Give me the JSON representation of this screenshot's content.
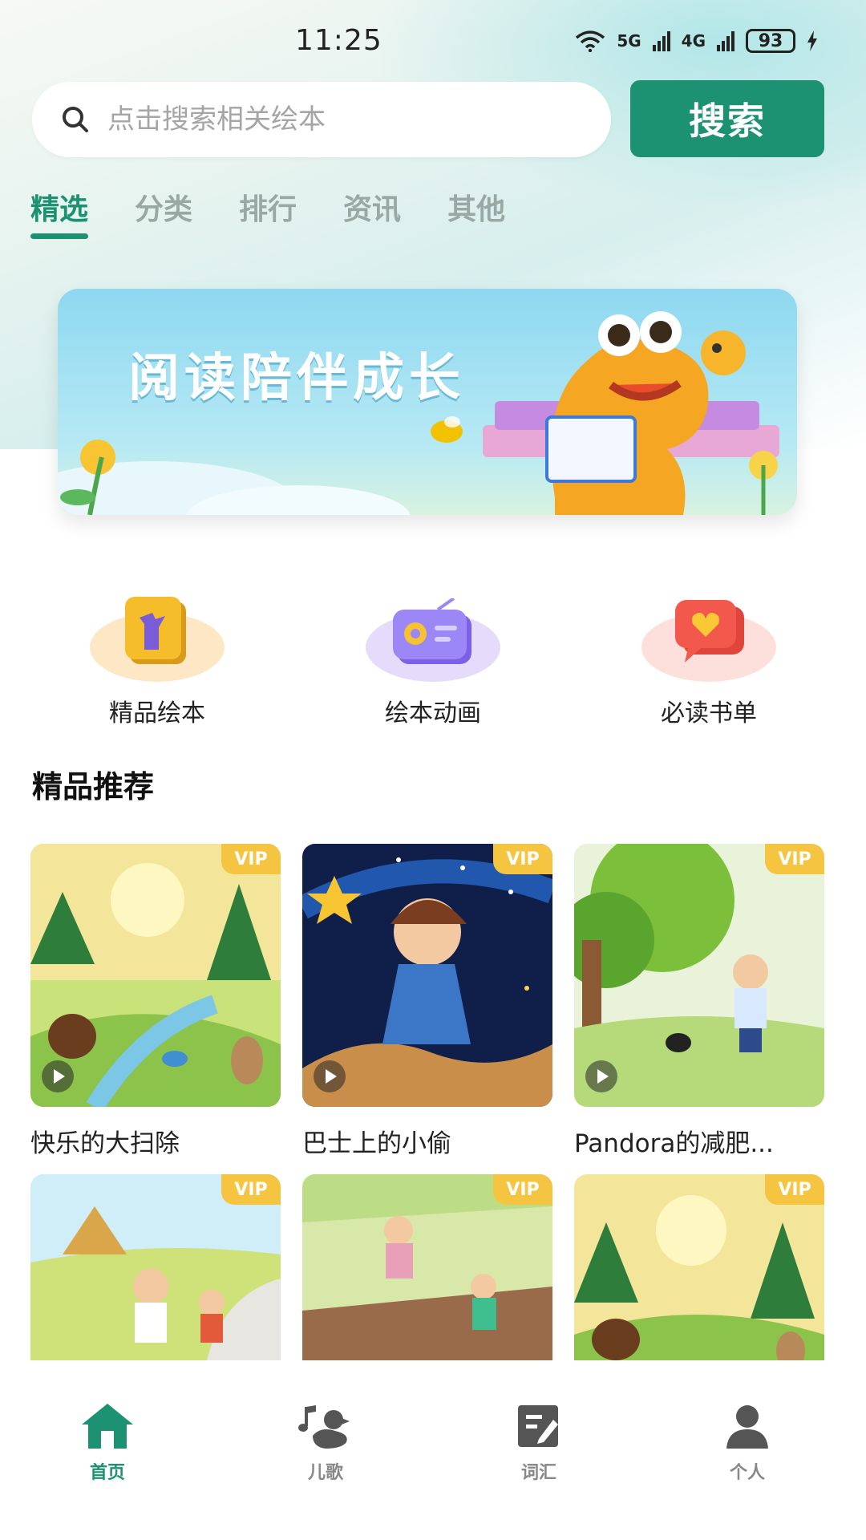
{
  "status_bar": {
    "time": "11:25",
    "network_1": "5G",
    "network_2": "4G",
    "battery": "93"
  },
  "search": {
    "placeholder": "点击搜索相关绘本",
    "button_label": "搜索",
    "icon": "search-icon"
  },
  "tabs": [
    {
      "label": "精选",
      "active": true
    },
    {
      "label": "分类",
      "active": false
    },
    {
      "label": "排行",
      "active": false
    },
    {
      "label": "资讯",
      "active": false
    },
    {
      "label": "其他",
      "active": false
    }
  ],
  "banner": {
    "text": "阅读陪伴成长"
  },
  "categories": [
    {
      "label": "精品绘本",
      "icon": "picture-book-icon",
      "color": "#fde7c4"
    },
    {
      "label": "绘本动画",
      "icon": "radio-icon",
      "color": "#e4dcfa"
    },
    {
      "label": "必读书单",
      "icon": "heart-chat-icon",
      "color": "#fde0dc"
    }
  ],
  "section": {
    "title": "精品推荐"
  },
  "books": [
    {
      "title": "快乐的大扫除",
      "badge": "VIP"
    },
    {
      "title": "巴士上的小偷",
      "badge": "VIP"
    },
    {
      "title": "Pandora的减肥...",
      "badge": "VIP"
    },
    {
      "title": "",
      "badge": "VIP"
    },
    {
      "title": "",
      "badge": "VIP"
    },
    {
      "title": "",
      "badge": "VIP"
    }
  ],
  "bottom_nav": [
    {
      "label": "首页",
      "icon": "home-icon",
      "active": true
    },
    {
      "label": "儿歌",
      "icon": "duck-music-icon",
      "active": false
    },
    {
      "label": "词汇",
      "icon": "edit-note-icon",
      "active": false
    },
    {
      "label": "个人",
      "icon": "person-icon",
      "active": false
    }
  ],
  "colors": {
    "accent": "#1d9272",
    "vip": "#f5c542"
  }
}
